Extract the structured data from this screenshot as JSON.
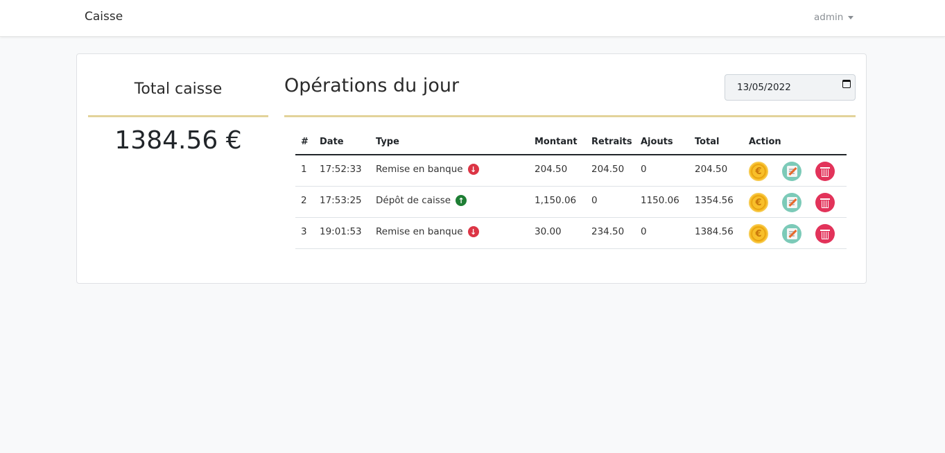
{
  "navbar": {
    "brand": "Caisse",
    "user": "admin"
  },
  "left_panel": {
    "title": "Total caisse",
    "total": "1384.56 €"
  },
  "operations": {
    "title": "Opérations du jour",
    "date_value": "13/05/2022",
    "headers": [
      "#",
      "Date",
      "Type",
      "Montant",
      "Retraits",
      "Ajouts",
      "Total",
      "Action"
    ],
    "rows": [
      {
        "num": "1",
        "time": "17:52:33",
        "type": "Remise en banque",
        "direction": "down",
        "montant": "204.50",
        "retraits": "204.50",
        "ajouts": "0",
        "total": "204.50"
      },
      {
        "num": "2",
        "time": "17:53:25",
        "type": "Dépôt de caisse",
        "direction": "up",
        "montant": "1,150.06",
        "retraits": "0",
        "ajouts": "1150.06",
        "total": "1354.56"
      },
      {
        "num": "3",
        "time": "19:01:53",
        "type": "Remise en banque",
        "direction": "down",
        "montant": "30.00",
        "retraits": "234.50",
        "ajouts": "0",
        "total": "1384.56"
      }
    ]
  },
  "icons": {
    "coin": "euro-coin-icon",
    "edit": "edit-note-icon",
    "delete": "trash-icon",
    "down": "arrow-down-circle-icon",
    "up": "arrow-up-circle-icon"
  },
  "colors": {
    "accent_rule": "#e3d39a",
    "down_arrow": "#dc3545",
    "up_arrow": "#1e7e34",
    "coin": "#f4b41a",
    "edit": "#7ccab8",
    "delete": "#e2335a"
  }
}
